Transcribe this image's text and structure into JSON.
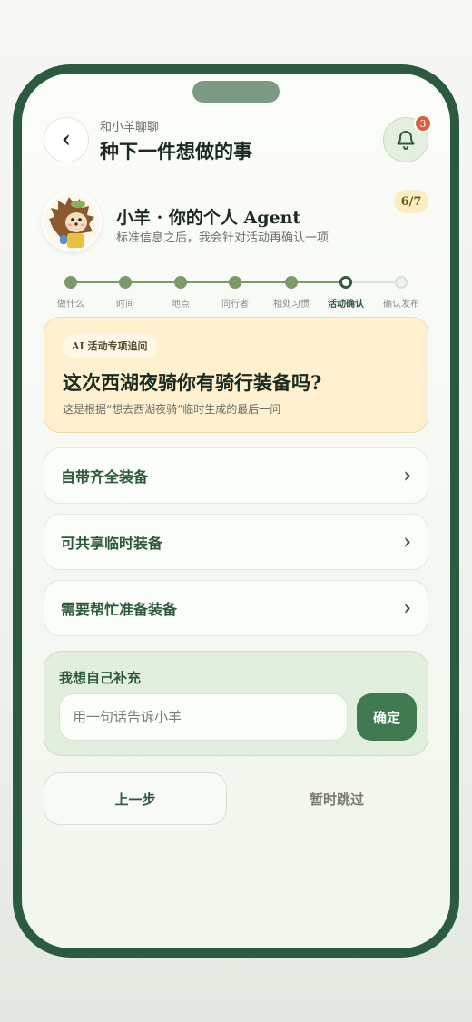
{
  "header": {
    "subtitle": "和小羊聊聊",
    "title": "种下一件想做的事",
    "back_icon": "chevron-left-icon",
    "bell_icon": "bell-icon",
    "notification_count": "3"
  },
  "agent": {
    "title": "小羊 · 你的个人 Agent",
    "description": "标准信息之后，我会针对活动再确认一项",
    "step_count": "6/7"
  },
  "steps": [
    {
      "label": "做什么",
      "state": "done"
    },
    {
      "label": "时间",
      "state": "done"
    },
    {
      "label": "地点",
      "state": "done"
    },
    {
      "label": "同行者",
      "state": "done"
    },
    {
      "label": "相处习惯",
      "state": "done"
    },
    {
      "label": "活动确认",
      "state": "current"
    },
    {
      "label": "确认发布",
      "state": "todo"
    }
  ],
  "question": {
    "tag": "AI 活动专项追问",
    "title": "这次西湖夜骑你有骑行装备吗?",
    "note": "这是根据“想去西湖夜骑”临时生成的最后一问"
  },
  "options": [
    {
      "label": "自带齐全装备"
    },
    {
      "label": "可共享临时装备"
    },
    {
      "label": "需要帮忙准备装备"
    }
  ],
  "custom": {
    "title": "我想自己补充",
    "placeholder": "用一句话告诉小羊",
    "confirm_label": "确定"
  },
  "footer": {
    "prev_label": "上一步",
    "skip_label": "暂时跳过"
  },
  "colors": {
    "frame": "#2c5a3f",
    "accent": "#3f7a50",
    "step_done": "#7a9a6a",
    "badge": "#d4603f",
    "question_bg": "#fff0cf"
  }
}
